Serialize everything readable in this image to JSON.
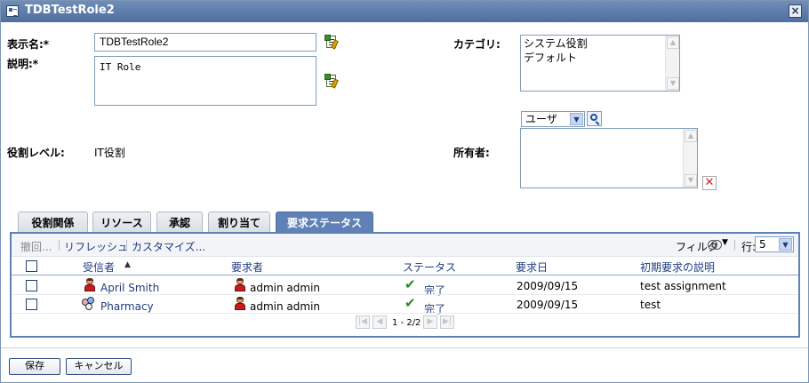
{
  "window": {
    "title": "TDBTestRole2",
    "close_symbol": "×"
  },
  "form": {
    "display_name_label": "表示名:*",
    "display_name_value": "TDBTestRole2",
    "description_label": "説明:*",
    "description_value": "IT Role",
    "role_level_label": "役割レベル:",
    "role_level_value": "IT役割",
    "category_label": "カテゴリ:",
    "categories": [
      "システム役割",
      "デフォルト"
    ],
    "owner_label": "所有者:",
    "owner_type_selected": "ユーザ"
  },
  "tabs": [
    {
      "label": "役割関係",
      "active": false
    },
    {
      "label": "リソース",
      "active": false
    },
    {
      "label": "承認",
      "active": false
    },
    {
      "label": "割り当て",
      "active": false
    },
    {
      "label": "要求ステータス",
      "active": true
    }
  ],
  "toolbar": {
    "retract": "撤回...",
    "refresh": "リフレッシュ",
    "customize": "カスタマイズ...",
    "filter": "フィルタ",
    "rows_label": "行:",
    "rows_value": "5"
  },
  "table": {
    "sort_indicator": "▲",
    "columns": [
      "受信者",
      "要求者",
      "ステータス",
      "要求日",
      "初期要求の説明"
    ],
    "rows": [
      {
        "recipient": "April Smith",
        "recipient_icon": "user-icon",
        "requester": "admin admin",
        "status": "完了",
        "date": "2009/09/15",
        "description": "test assignment"
      },
      {
        "recipient": "Pharmacy",
        "recipient_icon": "group-icon",
        "requester": "admin admin",
        "status": "完了",
        "date": "2009/09/15",
        "description": "test"
      }
    ]
  },
  "pager": {
    "text": "1 - 2/2"
  },
  "buttons": {
    "save": "保存",
    "cancel": "キャンセル"
  },
  "colors": {
    "accent": "#5f81b6",
    "titlebar": "#5b7bab",
    "link": "#1f3b80"
  }
}
